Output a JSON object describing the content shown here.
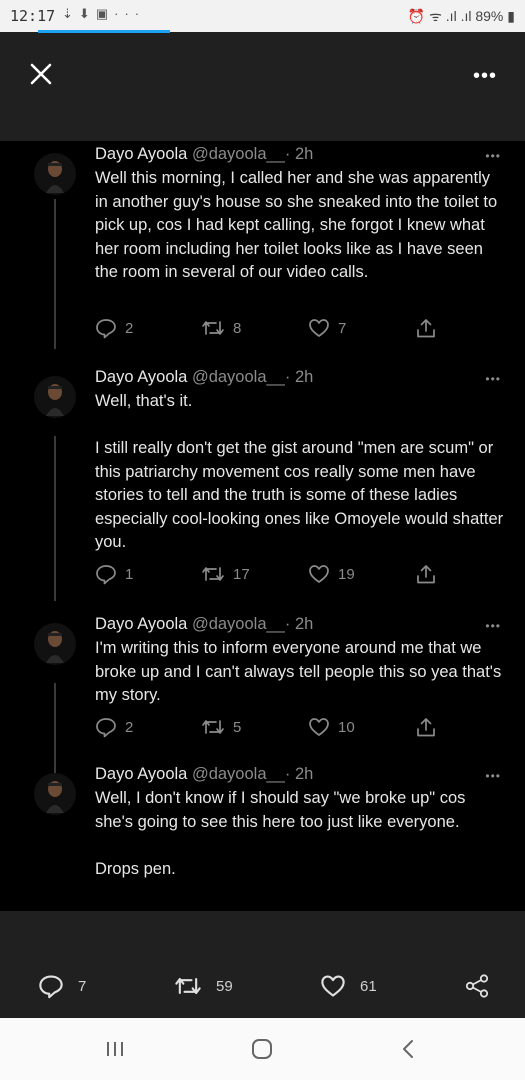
{
  "status_bar": {
    "time": "12:17",
    "battery": "89%"
  },
  "tweets": [
    {
      "name": "Dayo Ayoola",
      "handle": "@dayoola__",
      "time": "· 2h",
      "text": "Well this morning, I called her and she was apparently in another guy's house so she sneaked into the toilet to pick up, cos I had kept calling, she forgot I knew what her room including her toilet looks like as I have seen the room in several of our video calls.",
      "replies": "2",
      "retweets": "8",
      "likes": "7"
    },
    {
      "name": "Dayo Ayoola",
      "handle": "@dayoola__",
      "time": "· 2h",
      "text": "Well, that's it.\n\nI still really don't get the gist around \"men are scum\" or this patriarchy movement cos really some men have stories to tell and the truth is some of these ladies especially cool-looking ones like Omoyele would shatter you.",
      "replies": "1",
      "retweets": "17",
      "likes": "19"
    },
    {
      "name": "Dayo Ayoola",
      "handle": "@dayoola__",
      "time": "· 2h",
      "text": "I'm writing this to inform everyone around me that we broke up and I can't always tell people this so yea that's my story.",
      "replies": "2",
      "retweets": "5",
      "likes": "10"
    },
    {
      "name": "Dayo Ayoola",
      "handle": "@dayoola__",
      "time": "· 2h",
      "text": "Well, I don't know if I should say \"we broke up\" cos she's going to see this here too just like everyone.\n\nDrops pen."
    }
  ],
  "bottom_actions": {
    "replies": "7",
    "retweets": "59",
    "likes": "61"
  },
  "icons": {
    "close": "close-icon",
    "more": "more-icon",
    "reply": "reply-icon",
    "retweet": "retweet-icon",
    "like": "heart-icon",
    "share": "share-icon",
    "nav_recent": "recent-apps-icon",
    "nav_home": "home-icon",
    "nav_back": "back-icon"
  },
  "colors": {
    "accent": "#1da1f2",
    "background": "#000000",
    "chrome": "#202020"
  }
}
